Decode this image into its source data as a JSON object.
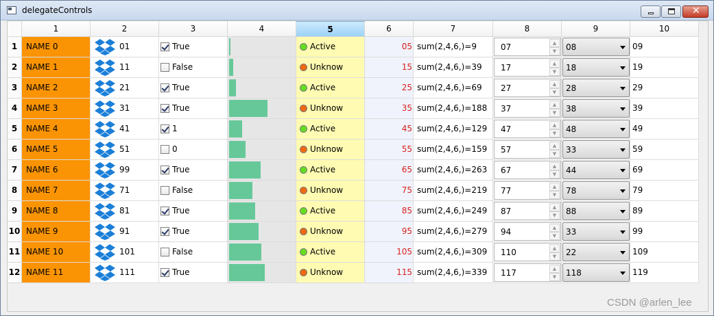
{
  "window": {
    "title": "delegateControls"
  },
  "columns": [
    "1",
    "2",
    "3",
    "4",
    "5",
    "6",
    "7",
    "8",
    "9",
    "10"
  ],
  "active_column": 4,
  "colors": {
    "name_cell": "#fb9404",
    "progress_bar": "#66c899",
    "status_cell": "#fffbb2",
    "active_dot": "#66dd22",
    "unknown_dot": "#f06a12",
    "value_text": "#d8201c"
  },
  "rows": [
    {
      "header": "1",
      "name": "NAME 0",
      "icon": "dropbox-icon",
      "num": "01",
      "checked": true,
      "check_label": "True",
      "progress": 0.02,
      "status": "Active",
      "active": true,
      "value": "05",
      "sum": "sum(2,4,6,)=9",
      "spin": "07",
      "combo": "08",
      "last": "09"
    },
    {
      "header": "2",
      "name": "NAME 1",
      "icon": "dropbox-icon",
      "num": "11",
      "checked": false,
      "check_label": "False",
      "progress": 0.06,
      "status": "Unknow",
      "active": false,
      "value": "15",
      "sum": "sum(2,4,6,)=39",
      "spin": "17",
      "combo": "18",
      "last": "19"
    },
    {
      "header": "3",
      "name": "NAME 2",
      "icon": "dropbox-icon",
      "num": "21",
      "checked": true,
      "check_label": "True",
      "progress": 0.1,
      "status": "Active",
      "active": true,
      "value": "25",
      "sum": "sum(2,4,6,)=69",
      "spin": "27",
      "combo": "28",
      "last": "29"
    },
    {
      "header": "4",
      "name": "NAME 3",
      "icon": "dropbox-icon",
      "num": "31",
      "checked": true,
      "check_label": "True",
      "progress": 0.58,
      "status": "Unknow",
      "active": false,
      "value": "35",
      "sum": "sum(2,4,6,)=188",
      "spin": "37",
      "combo": "38",
      "last": "39"
    },
    {
      "header": "5",
      "name": "NAME 4",
      "icon": "dropbox-icon",
      "num": "41",
      "checked": true,
      "check_label": "1",
      "progress": 0.2,
      "status": "Active",
      "active": true,
      "value": "45",
      "sum": "sum(2,4,6,)=129",
      "spin": "47",
      "combo": "48",
      "last": "49"
    },
    {
      "header": "6",
      "name": "NAME 5",
      "icon": "dropbox-icon",
      "num": "51",
      "checked": false,
      "check_label": "0",
      "progress": 0.25,
      "status": "Unknow",
      "active": false,
      "value": "55",
      "sum": "sum(2,4,6,)=159",
      "spin": "57",
      "combo": "33",
      "last": "59"
    },
    {
      "header": "7",
      "name": "NAME 6",
      "icon": "dropbox-icon",
      "num": "99",
      "checked": true,
      "check_label": "True",
      "progress": 0.48,
      "status": "Active",
      "active": true,
      "value": "65",
      "sum": "sum(2,4,6,)=263",
      "spin": "67",
      "combo": "44",
      "last": "69"
    },
    {
      "header": "8",
      "name": "NAME 7",
      "icon": "dropbox-icon",
      "num": "71",
      "checked": false,
      "check_label": "False",
      "progress": 0.35,
      "status": "Unknow",
      "active": false,
      "value": "75",
      "sum": "sum(2,4,6,)=219",
      "spin": "77",
      "combo": "78",
      "last": "79"
    },
    {
      "header": "9",
      "name": "NAME 8",
      "icon": "dropbox-icon",
      "num": "81",
      "checked": true,
      "check_label": "True",
      "progress": 0.4,
      "status": "Active",
      "active": true,
      "value": "85",
      "sum": "sum(2,4,6,)=249",
      "spin": "87",
      "combo": "88",
      "last": "89"
    },
    {
      "header": "10",
      "name": "NAME 9",
      "icon": "dropbox-icon",
      "num": "91",
      "checked": true,
      "check_label": "True",
      "progress": 0.45,
      "status": "Unknow",
      "active": false,
      "value": "95",
      "sum": "sum(2,4,6,)=279",
      "spin": "94",
      "combo": "33",
      "last": "99"
    },
    {
      "header": "11",
      "name": "NAME 10",
      "icon": "dropbox-icon",
      "num": "101",
      "checked": false,
      "check_label": "False",
      "progress": 0.49,
      "status": "Active",
      "active": true,
      "value": "105",
      "sum": "sum(2,4,6,)=309",
      "spin": "110",
      "combo": "22",
      "last": "109"
    },
    {
      "header": "12",
      "name": "NAME 11",
      "icon": "dropbox-icon",
      "num": "111",
      "checked": true,
      "check_label": "True",
      "progress": 0.54,
      "status": "Unknow",
      "active": false,
      "value": "115",
      "sum": "sum(2,4,6,)=339",
      "spin": "117",
      "combo": "118",
      "last": "119"
    }
  ],
  "watermark": "CSDN @arlen_lee"
}
